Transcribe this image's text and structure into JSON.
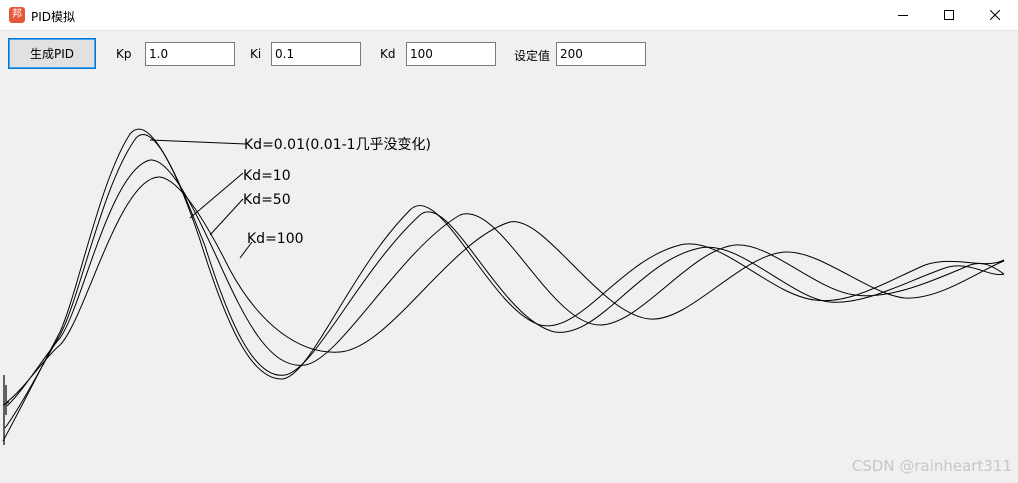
{
  "window": {
    "icon_text": "邦",
    "title": "PID模拟",
    "minimize_icon": "minimize-icon",
    "maximize_icon": "maximize-icon",
    "close_icon": "close-icon"
  },
  "toolbar": {
    "generate_label": "生成PID",
    "kp_label": "Kp",
    "kp_value": "1.0",
    "ki_label": "Ki",
    "ki_value": "0.1",
    "kd_label": "Kd",
    "kd_value": "100",
    "setpoint_label": "设定值",
    "setpoint_value": "200"
  },
  "plot": {
    "line_color": "#000000",
    "annotations": [
      "Kd=0.01(0.01-1几乎没变化)",
      "Kd=10",
      "Kd=50",
      "Kd=100"
    ]
  },
  "watermark": "CSDN @rainheart311"
}
